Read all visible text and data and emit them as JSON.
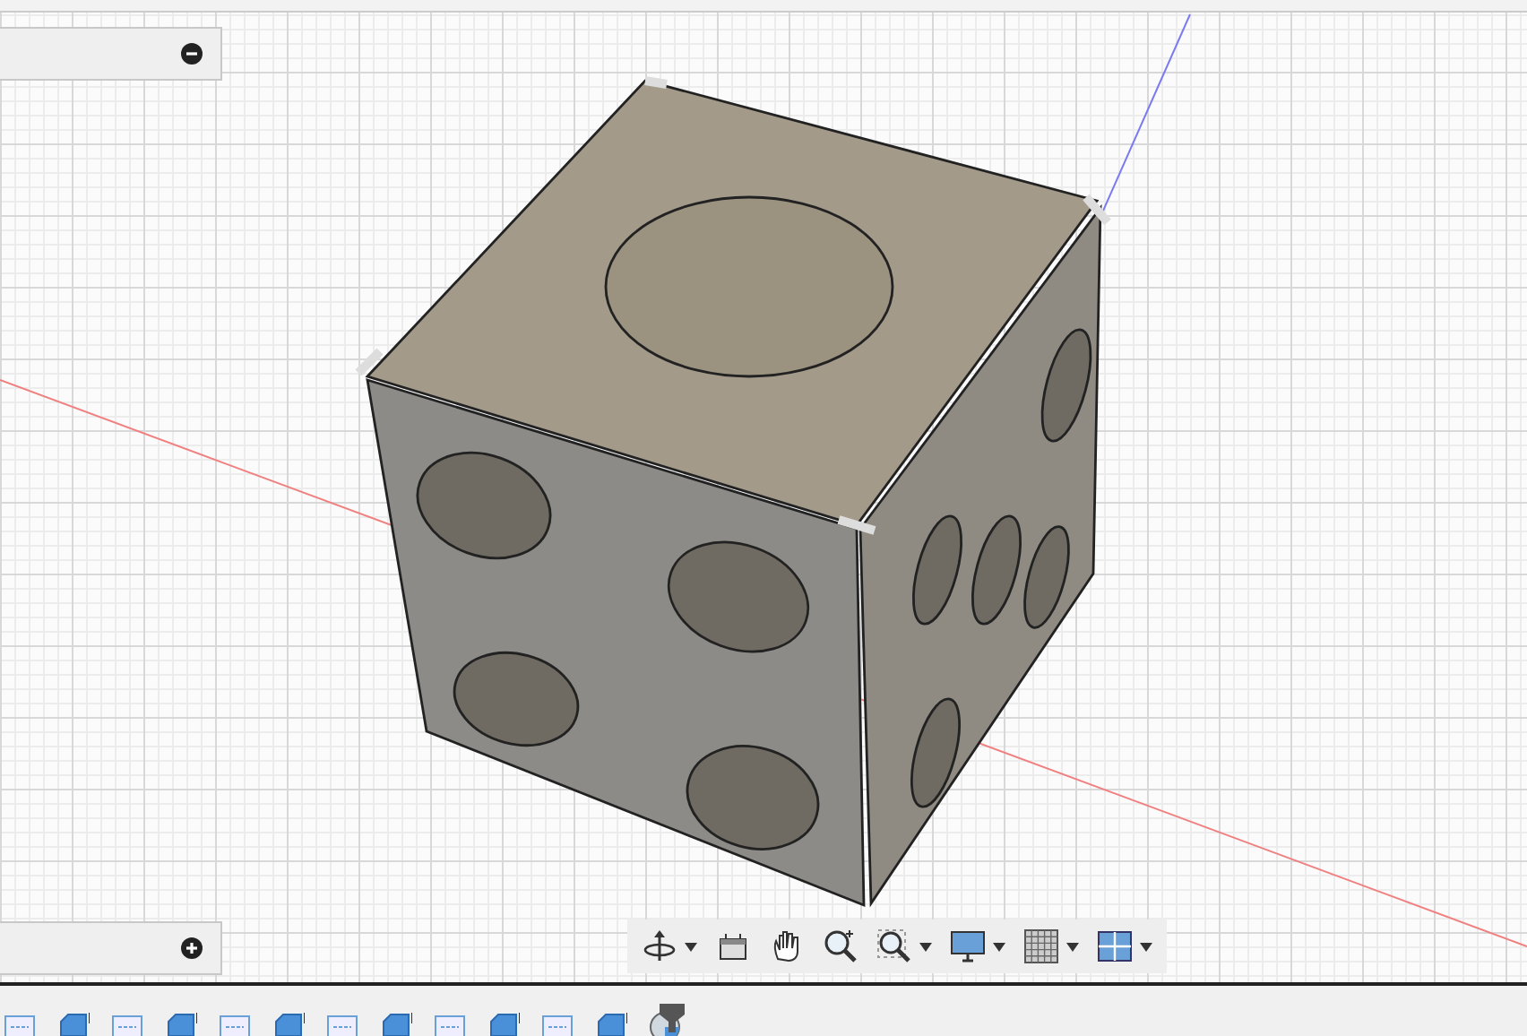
{
  "panels": [
    {
      "expanded": true
    },
    {
      "expanded": false
    }
  ],
  "nav_toolbar": [
    {
      "kind": "orbit",
      "dropdown": true
    },
    {
      "kind": "look-at",
      "dropdown": false
    },
    {
      "kind": "pan",
      "dropdown": false
    },
    {
      "kind": "zoom",
      "dropdown": false
    },
    {
      "kind": "fit",
      "dropdown": true
    },
    {
      "kind": "display",
      "dropdown": true
    },
    {
      "kind": "grid",
      "dropdown": true
    },
    {
      "kind": "viewports",
      "dropdown": true
    }
  ],
  "timeline": [
    {
      "kind": "sketch"
    },
    {
      "kind": "extrude"
    },
    {
      "kind": "sketch"
    },
    {
      "kind": "extrude"
    },
    {
      "kind": "sketch"
    },
    {
      "kind": "extrude"
    },
    {
      "kind": "sketch"
    },
    {
      "kind": "extrude"
    },
    {
      "kind": "sketch"
    },
    {
      "kind": "extrude"
    },
    {
      "kind": "sketch"
    },
    {
      "kind": "extrude"
    },
    {
      "kind": "fillet"
    }
  ]
}
